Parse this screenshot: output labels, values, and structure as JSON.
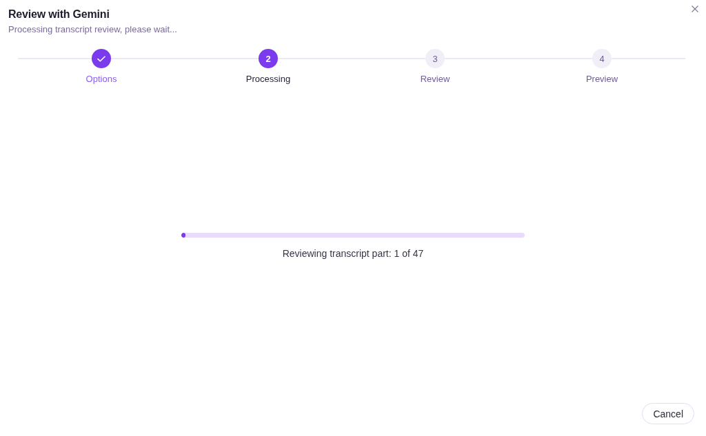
{
  "dialog": {
    "title": "Review with Gemini",
    "subtitle": "Processing transcript review, please wait..."
  },
  "steps": [
    {
      "label": "Options",
      "completed": true,
      "selected": false
    },
    {
      "number": "2",
      "label": "Processing",
      "completed": false,
      "selected": true
    },
    {
      "number": "3",
      "label": "Review",
      "completed": false,
      "selected": false
    },
    {
      "number": "4",
      "label": "Preview",
      "completed": false,
      "selected": false
    }
  ],
  "progress": {
    "level": 0.012,
    "status": "Reviewing transcript part: 1 of 47"
  },
  "buttons": [
    {
      "label": "Cancel"
    }
  ]
}
